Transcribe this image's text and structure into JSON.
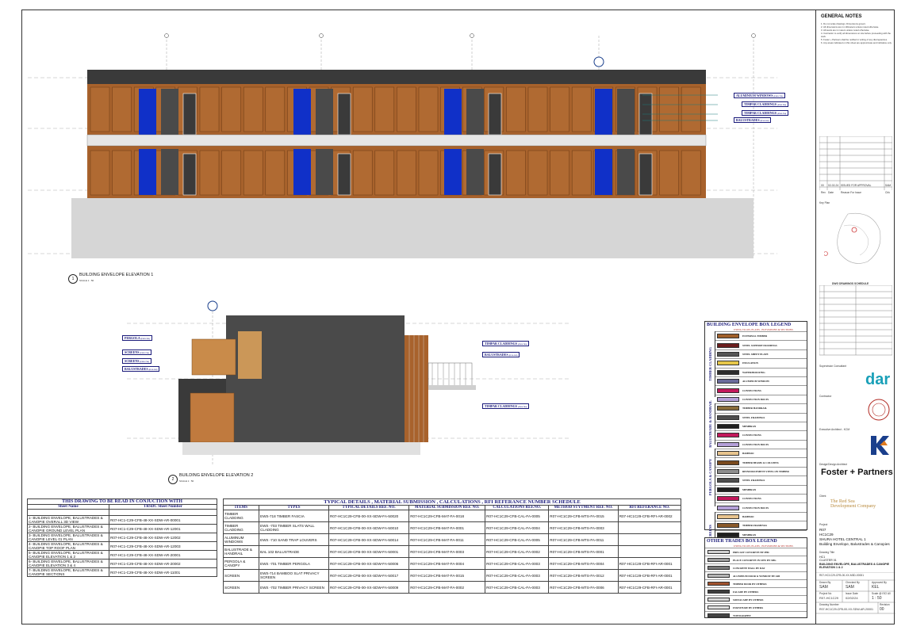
{
  "elevation1": {
    "number": "1",
    "title": "BUILDING ENVELOPE ELEVATION 1",
    "scale": "SCALE 1 : 50"
  },
  "elevation2": {
    "number": "2",
    "title": "BUILDING ENVELOPE ELEVATION 2",
    "scale": "SCALE 1 : 50"
  },
  "callouts1": [
    "ALUMINIUM WINDOWS",
    "TIMPAR CLADDINGS",
    "TIMPAR CLADDINGS",
    "BALUSTRADES"
  ],
  "callout_codes1": [
    "(EWS-713)",
    "(EWS-703)",
    "(EWS-714)",
    "(BAL-102)"
  ],
  "callouts2_left": [
    "PERGOLA",
    "SCREENS",
    "SCREENS",
    "BALUSTRADES"
  ],
  "callout_codes2_left": [
    "(EWS-701)",
    "(EWS-714)",
    "(EWS-714)",
    "(BAL-102)"
  ],
  "callouts2_right": [
    "TIMPAR CLADDINGS",
    "BALUSTRADES",
    "TIMPAR CLADDINGS"
  ],
  "callout_codes2_right": [
    "(EWS-703)",
    "(BAL-102)",
    "(EWS-703)"
  ],
  "conjunction": {
    "title": "THIS DRAWING TO BE READ IN CONJUCTION WITH",
    "headers": [
      "Sheet Name",
      "TRSDC Sheet Number"
    ],
    "rows": [
      [
        "1- BUILDING ENVELOPE, BALUSTRADES & CANOPIE OVERALL 3D VIEW",
        "R07-HC1-C29-CFB-48-XX-SDW-AR-00001"
      ],
      [
        "2- BUILDING ENVELOPE, BALUSTRADES & CANOPIE GROUND LEVEL PLAN",
        "R07-HC1-C29-CFB-48-XX-SDW-AR-12001"
      ],
      [
        "3- BUILDING ENVELOPE, BALUSTRADES & CANOPIE LEVEL 01 PLAN",
        "R07-HC1-C29-CFB-48-XX-SDW-AR-12002"
      ],
      [
        "4- BUILDING ENVELOPE, BALUSTRADES & CANOPIE TOP ROOF PLAN",
        "R07-HC1-C29-CFB-48-XX-SDW-AR-12003"
      ],
      [
        "5- BUILDING ENVELOPE, BALUSTRADES & CANOPIE ELEVATION 1 & 2",
        "R07-HC1-C29-CFB-48-XX-SDW-AR-20001"
      ],
      [
        "6- BUILDING ENVELOPE, BALUSTRADES & CANOPIE ELEVATION 3 & 4",
        "R07-HC1-C29-CFB-48-XX-SDW-AR-20002"
      ],
      [
        "7- BUILDING ENVELOPE, BALUSTRADES & CANOPIE SECTIONS",
        "R07-HC1-C29-CFB-48-XX-SDW-AR-11001"
      ]
    ]
  },
  "schedule": {
    "title": "TYPICAL DETAILS , MATERIAL SUBMISSION , CALCULATIONS , RFI REFERANCE NUMBER SCHEDULE",
    "headers": [
      "ITEMS",
      "TYPES",
      "TYPICAL DETAILS REF. NO.",
      "MATERIAL SUBMISSION REF. NO.",
      "CALCULATIONS REF.NO.",
      "METHOD STYTMENT REF. NO.",
      "RFI REFERANCE NO."
    ],
    "rows": [
      [
        "TIMBER CLADDING",
        "EWS-718 TIMBER FASCIA",
        "R07-HC1C29-CFB-00-XX-SDW-FA-50020",
        "R07-HC1C29-CFB-MAT-FA-0018",
        "R07-HC1C29-CFB-CAL-FA-0005",
        "R07-HC1C29-CFB-MTS-FA-0015",
        "R07-HC1C29-CFB-RFI-AR-0002"
      ],
      [
        "TIMBER CLADDING",
        "EWS -703 TIMBER SLATS WALL CLADDING",
        "R07-HC1C29-CFB-00-XX-SDW-FA-50010",
        "R07-HC1C29-CFB-MAT-FA-0001",
        "R07-HC1C29-CFB-CAL-FA-0004",
        "R07-HC1C29-CFB-MTS-FA-0003",
        ""
      ],
      [
        "ALUMINUM WINDOWS",
        "EWS -710 SAND TRAP LOUVERS",
        "R07-HC1C29-CFB-00-XX-SDW-FA-50014",
        "R07-HC1C29-CFB-MAT-FA-0011",
        "R07-HC1C29-CFB-CAL-FA-0005",
        "R07-HC1C29-CFB-MTS-FA-0011",
        ""
      ],
      [
        "BALUSTRADE & HANDRAIL",
        "BAL 102 BALUSTRADE",
        "R07-HC1C29-CFB-00-XX-SDW-FA-50001",
        "R07-HC1C29-CFB-MAT-FA-0003",
        "R07-HC1C29-CFB-CAL-FA-0002",
        "R07-HC1C29-CFB-MTS-FA-0001",
        ""
      ],
      [
        "PERGOLA & CANOPY",
        "EWS -701 TIMBER PERGOLA",
        "R07-HC1C29-CFB-00-XX-SDW-FA-50006",
        "R07-HC1C29-CFB-MAT-FA-0004",
        "R07-HC1C29-CFB-CAL-FA-0003",
        "R07-HC1C29-CFB-MTS-FA-0004",
        "R07-HC1C29-CFB-RFI-AR-0001"
      ],
      [
        "SCREEN",
        "EWS-714 BAMBOO SLAT PRIVACY SCREEN",
        "R07-HC1C29-CFB-00-XX-SDW-FA-50017",
        "R07-HC1C29-CFB-MAT-FA-0015",
        "R07-HC1C29-CFB-CAL-FA-0003",
        "R07-HC1C29-CFB-MTS-FA-0012",
        "R07-HC1C29-CFB-RFI-AR-0001"
      ],
      [
        "SCREEN",
        "EWS -702 TIMBER PRIVACY SCREEN",
        "R07-HC1C29-CFB-00-XX-SDW-FA-50009",
        "R07-HC1C29-CFB-MAT-FA-0002",
        "R07-HC1C29-CFB-CAL-FA-0003",
        "R07-HC1C29-CFB-MTS-FA-0006",
        "R07-HC1C29-CFB-RFI-AR-0001"
      ]
    ]
  },
  "legend": {
    "title": "BUILDING ENVELOPE BOX LEGEND",
    "subtitle": "USING TO ON, PLANS , ELEVATIONS & SECTIONS",
    "groups": [
      {
        "name": "TIMBER CLADDING",
        "items": [
          {
            "label": "EXTERNAL TIMBER",
            "color": "#a0602a"
          },
          {
            "label": "STEEL SUPPORT FRAMINGS",
            "color": "#6b1e1e"
          },
          {
            "label": "STEEL SHEET PLATE",
            "color": "#555555"
          },
          {
            "label": "INSULATION",
            "color": "#e6c74a"
          },
          {
            "label": "WATERPROOFING",
            "color": "#2d2d2d"
          },
          {
            "label": "ALUMINUM WINDOW",
            "color": "#6a6a9a"
          },
          {
            "label": "CONNECTIONS",
            "color": "#c2185b"
          },
          {
            "label": "CONNECTION BOLTS",
            "color": "#b4a0d8"
          }
        ]
      },
      {
        "name": "BALUSTRADE & HANDRAIL",
        "items": [
          {
            "label": "TIMBER HANDRAIL",
            "color": "#8a6d3b"
          },
          {
            "label": "STEEL FRAMINGS",
            "color": "#4d4d4d"
          },
          {
            "label": "MEMBRAN",
            "color": "#1f1f1f"
          },
          {
            "label": "CONNECTIONS",
            "color": "#c2185b"
          },
          {
            "label": "CONNECTION BOLTS",
            "color": "#b4a0d8"
          }
        ]
      },
      {
        "name": "PERGOLA & CANOPY",
        "items": [
          {
            "label": "BAMBOO",
            "color": "#e8c48e"
          },
          {
            "label": "TIMBER BEAMS & COLUMNS",
            "color": "#7a4a1e"
          },
          {
            "label": "REINFORCEMENT STEEL ON TIMBER",
            "color": "#8e8e8e"
          },
          {
            "label": "STEEL FRAMINGS",
            "color": "#4d4d4d"
          },
          {
            "label": "MEMBRAN",
            "color": "#1f1f1f"
          },
          {
            "label": "CONNECTIONS",
            "color": "#c2185b"
          },
          {
            "label": "CONNECTION BOLTS",
            "color": "#b4a0d8"
          }
        ]
      },
      {
        "name": "SCREENS",
        "items": [
          {
            "label": "BAMBOO",
            "color": "#e8c48e"
          },
          {
            "label": "TIMBER FRAMINGS",
            "color": "#8a5a2b"
          },
          {
            "label": "MEMBRAN",
            "color": "#1f1f1f"
          },
          {
            "label": "CONNECTIONS",
            "color": "#c2185b"
          },
          {
            "label": "CONNECTION BOLTS",
            "color": "#b4a0d8"
          }
        ]
      }
    ]
  },
  "other_legend": {
    "title": "OTHER TRADES BOX LEGEND",
    "subtitle": "USING TO ON, PLANS , ELEVATIONS & SECTIONS",
    "items": [
      {
        "label": "PRECAST CONCRETE BY PHC",
        "color": "#cfcfcf"
      },
      {
        "label": "PLACE CONCRETE IN SITU BY SBG",
        "color": "#9e9e9e"
      },
      {
        "label": "CONCRETE WALL BY DAF",
        "color": "#7a7a7a"
      },
      {
        "label": "ALUMINUM DOOR & WINDOW BY ADI",
        "color": "#b6b6b6"
      },
      {
        "label": "TIMBER DOOR BY OTHERS",
        "color": "#a0522d"
      },
      {
        "label": "FACADE BY OTHERS",
        "color": "#3d3d3d"
      },
      {
        "label": "SOFFACADE BY OTHERS",
        "color": "#d8d8d8"
      },
      {
        "label": "FURNITURE BY OTHERS",
        "color": "#e0e0e0"
      },
      {
        "label": "TOPOGRAPHY",
        "color": "#444444"
      }
    ]
  },
  "titleblock": {
    "general_notes_title": "GENERAL NOTES",
    "notes": [
      "1. Do not scale drawings. Dimensions govern.",
      "2. All dimensions are in millimeters unless noted otherwise.",
      "3. All levels are in meters unless noted otherwise.",
      "4. Contractor to verify all dimensions on site before proceeding with the work.",
      "5. Foster + Partners shall be notified in writing of any discrepancies.",
      "6. Any areas indicated on this sheet are approximate and indicative only."
    ],
    "revision": {
      "rev": "00",
      "date": "02-02-24",
      "desc": "ISSUED FOR APPROVAL",
      "by": "SAM"
    },
    "rev_headers": [
      "Rev",
      "Date",
      "Reason For Issue",
      "Chk"
    ],
    "key_plan": "Key Plan",
    "supervision": "Supervision Consultant",
    "contractor": "Contractor",
    "exec_architect": "Executive Architect - KCM",
    "design_architect": "Design/Design Architect",
    "fp_logo": "Foster + Partners",
    "client": "Client",
    "client_logo": "The Red Sea Development Company",
    "dar_logo": "dar",
    "project_label": "Project",
    "project": [
      "R07",
      "HC1C29",
      "SHURA HOTEL CENTRAL 1",
      "Building Envelope, Balustrades & Canopies"
    ],
    "drawing_title_label": "Drawing Title",
    "drawing_title": [
      "HC1",
      "CLUSTER 01",
      "BUILDING ENVELOPE, BALUSTRADES & CANOPIE ELEVATION 1 & 2"
    ],
    "model_file": "R07-HC1C29-CFB-00-XX-M3D-00001",
    "drawn_by": "SAM",
    "checked_by": "SAM",
    "approved_by": "KEL",
    "project_no": "R07-HC1C29",
    "issue_date": "02/02/24",
    "scale": "1 : 50",
    "drawing_number": "R07-HC1C29-CFB-00-XX-SDW-AR-20001",
    "revision_no": "00",
    "labels": {
      "drawn": "Drawn By",
      "checked": "Checked By",
      "approved": "Approved By",
      "projno": "Project No",
      "issue": "Issue Date",
      "scale": "Scale @ ISO A0",
      "dwgno": "Drawing Number",
      "rev": "Revision"
    }
  },
  "dwg_list_title": "DWG DRAWINGS SCHEDULE"
}
